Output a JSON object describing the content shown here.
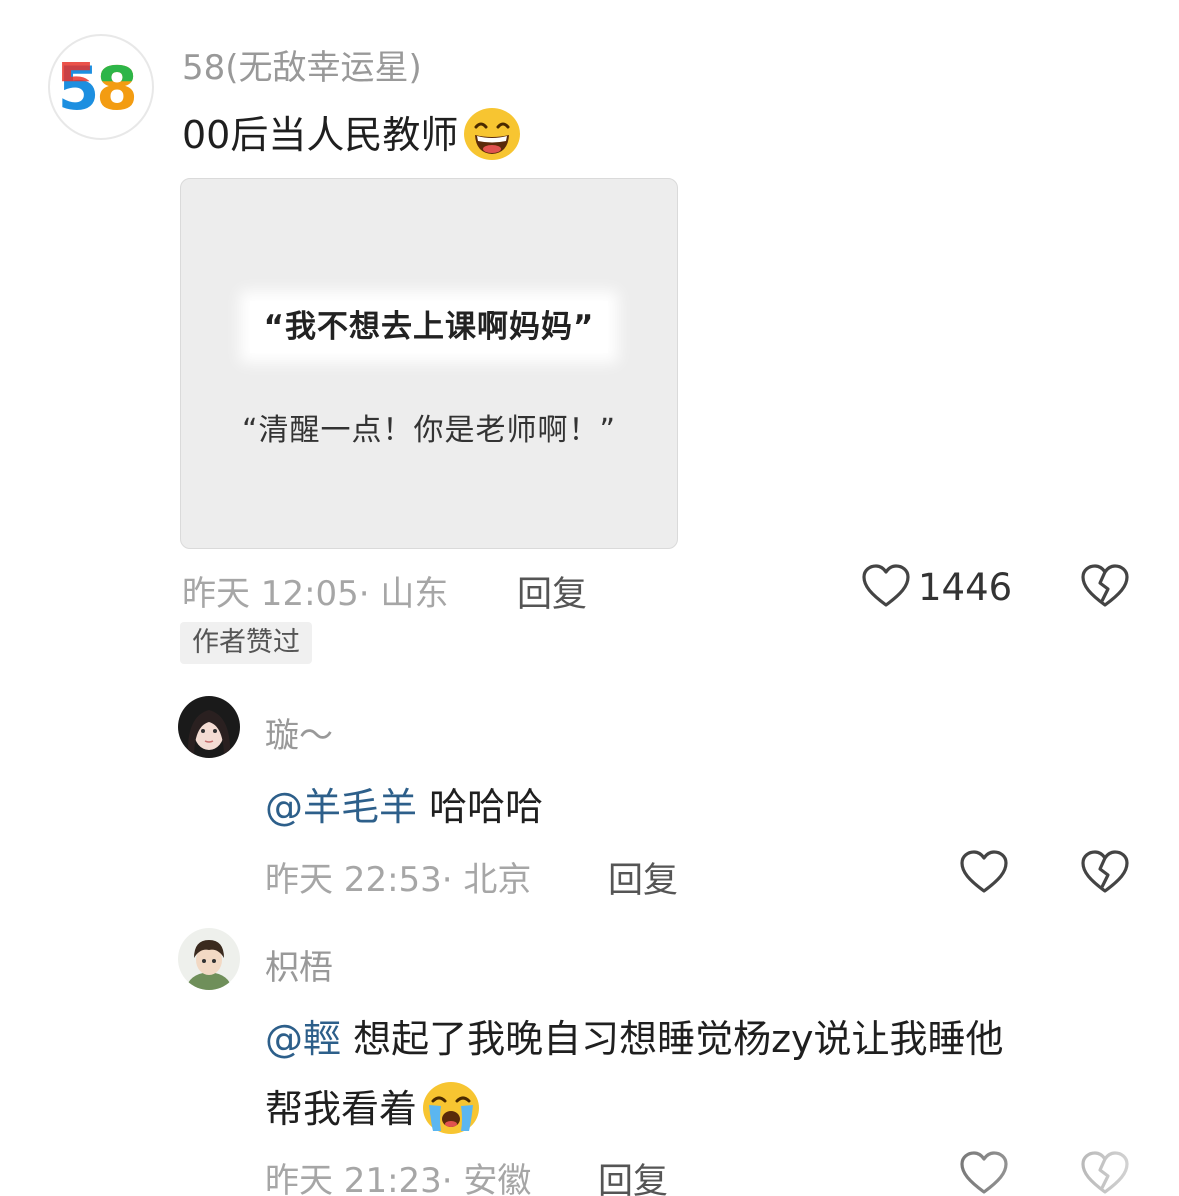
{
  "comments": [
    {
      "username": "58(无敌幸运星)",
      "avatar_text": "58",
      "content": "00后当人民教师",
      "emoji": "grinning-face",
      "image": {
        "line1": "“我不想去上课啊妈妈”",
        "line2": "“清醒一点！你是老师啊！”"
      },
      "meta": "昨天 12:05· 山东",
      "reply_label": "回复",
      "like_count": "1446",
      "badge": "作者赞过"
    },
    {
      "username": "璇～",
      "mention": "@羊毛羊",
      "content": "哈哈哈",
      "meta": "昨天 22:53· 北京",
      "reply_label": "回复"
    },
    {
      "username": "枳梧",
      "mention": "@輕",
      "content_line1": "想起了我晚自习想睡觉杨zy说让我睡他",
      "content_line2": "帮我看着",
      "emoji": "loudly-crying-face",
      "meta": "昨天 21:23· 安徽",
      "reply_label": "回复"
    }
  ],
  "colors": {
    "mention": "#2d5f8a",
    "meta": "#a6a6a6",
    "logo_red": "#e8342b",
    "logo_blue": "#1d8fe0",
    "logo_green": "#2db548",
    "logo_orange": "#f39c12"
  }
}
